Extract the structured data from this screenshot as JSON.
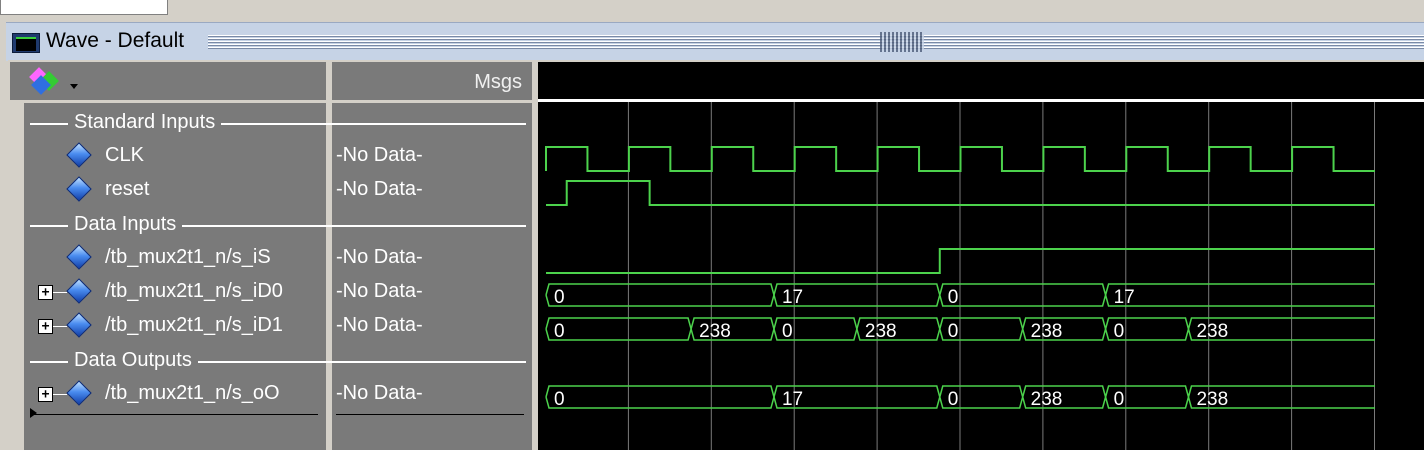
{
  "window": {
    "title": "Wave - Default"
  },
  "columns": {
    "msgs_header": "Msgs"
  },
  "toolbar": {
    "icon": "wave-tools-icon"
  },
  "groups": [
    {
      "label": "Standard Inputs"
    },
    {
      "label": "Data Inputs"
    },
    {
      "label": "Data Outputs"
    }
  ],
  "signals": [
    {
      "name": "CLK",
      "msg": "-No Data-",
      "expandable": false
    },
    {
      "name": "reset",
      "msg": "-No Data-",
      "expandable": false
    },
    {
      "name": "/tb_mux2t1_n/s_iS",
      "msg": "-No Data-",
      "expandable": false
    },
    {
      "name": "/tb_mux2t1_n/s_iD0",
      "msg": "-No Data-",
      "expandable": true
    },
    {
      "name": "/tb_mux2t1_n/s_iD1",
      "msg": "-No Data-",
      "expandable": true
    },
    {
      "name": "/tb_mux2t1_n/s_oO",
      "msg": "-No Data-",
      "expandable": true
    }
  ],
  "waveforms": {
    "time_start": 0,
    "time_end": 200,
    "grid_times": [
      20,
      40,
      60,
      80,
      100,
      120,
      140,
      160,
      180,
      200
    ],
    "clk_period": 20,
    "reset": {
      "rise": 5,
      "fall": 25
    },
    "s_iS": {
      "high_from": 95
    },
    "s_iD0": [
      {
        "t": 0,
        "v": "0"
      },
      {
        "t": 55,
        "v": "17"
      },
      {
        "t": 95,
        "v": "0"
      },
      {
        "t": 135,
        "v": "17"
      }
    ],
    "s_iD1": [
      {
        "t": 0,
        "v": "0"
      },
      {
        "t": 35,
        "v": "238"
      },
      {
        "t": 55,
        "v": "0"
      },
      {
        "t": 75,
        "v": "238"
      },
      {
        "t": 95,
        "v": "0"
      },
      {
        "t": 115,
        "v": "238"
      },
      {
        "t": 135,
        "v": "0"
      },
      {
        "t": 155,
        "v": "238"
      }
    ],
    "s_oO": [
      {
        "t": 0,
        "v": "0"
      },
      {
        "t": 55,
        "v": "17"
      },
      {
        "t": 95,
        "v": "0"
      },
      {
        "t": 115,
        "v": "238"
      },
      {
        "t": 135,
        "v": "0"
      },
      {
        "t": 155,
        "v": "238"
      }
    ]
  },
  "colors": {
    "wave": "#4cd24c",
    "grid": "#7a7a7a",
    "background": "#000000",
    "panel": "#7a7a7a"
  }
}
